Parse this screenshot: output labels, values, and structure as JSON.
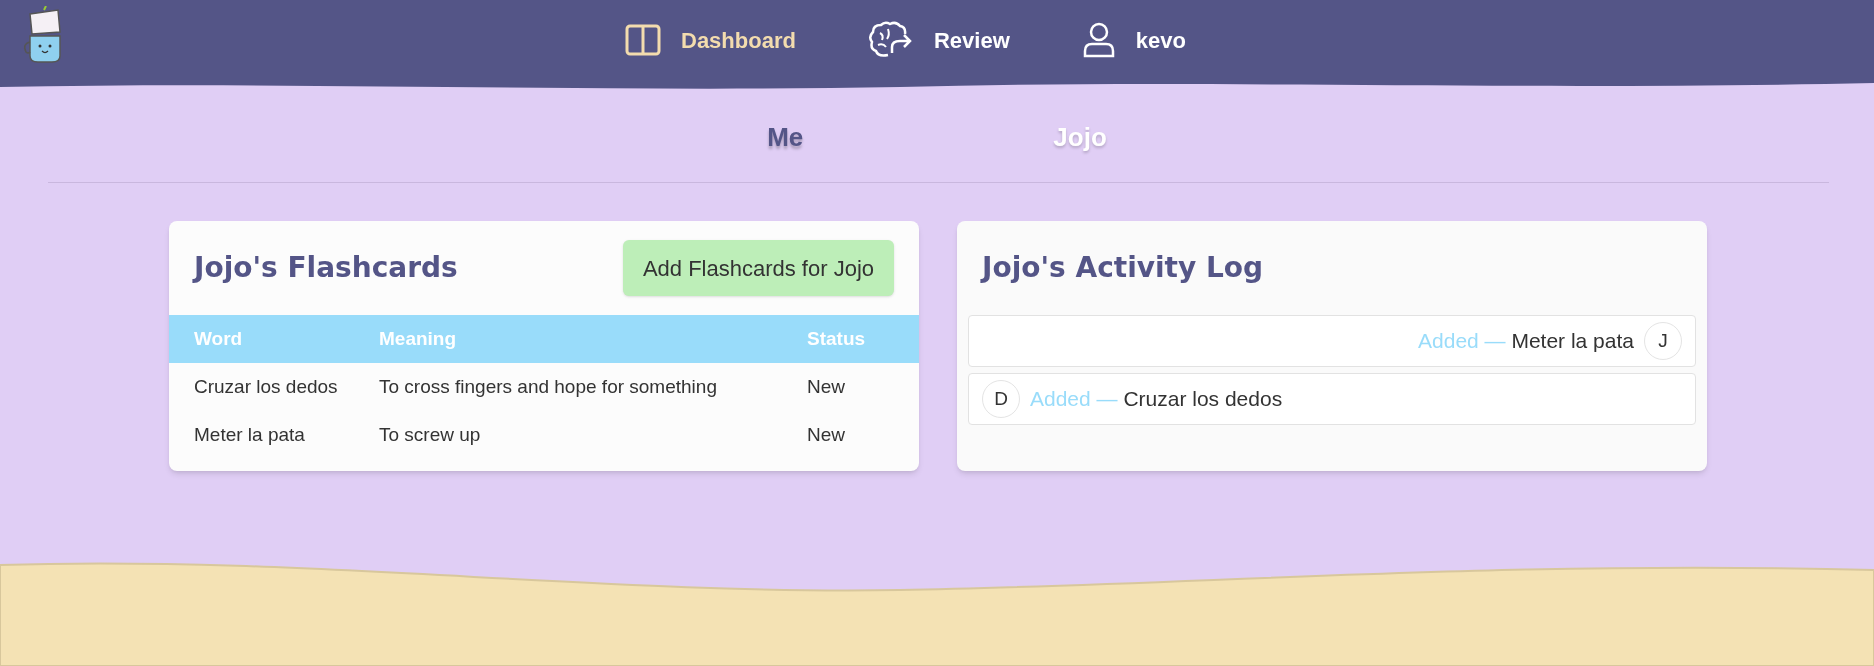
{
  "nav": {
    "items": [
      {
        "label": "Dashboard",
        "selected": true
      },
      {
        "label": "Review",
        "selected": false
      },
      {
        "label": "kevo",
        "selected": false
      }
    ]
  },
  "people_tabs": [
    {
      "label": "Me",
      "selected": false
    },
    {
      "label": "Jojo",
      "selected": true
    }
  ],
  "flashcards": {
    "title": "Jojo's Flashcards",
    "button": "Add Flashcards for Jojo",
    "columns": [
      "Word",
      "Meaning",
      "Status"
    ],
    "rows": [
      [
        "Cruzar los dedos",
        "To cross fingers and hope for something",
        "New"
      ],
      [
        "Meter la pata",
        "To screw up",
        "New"
      ]
    ]
  },
  "activity_log": {
    "title": "Jojo's Activity Log",
    "entries": [
      {
        "kind": "right",
        "action": "Added —",
        "item": "Meter la pata",
        "avatar": "J"
      },
      {
        "kind": "left",
        "action": "Added —",
        "item": "Cruzar los dedos",
        "avatar": "D"
      }
    ]
  }
}
